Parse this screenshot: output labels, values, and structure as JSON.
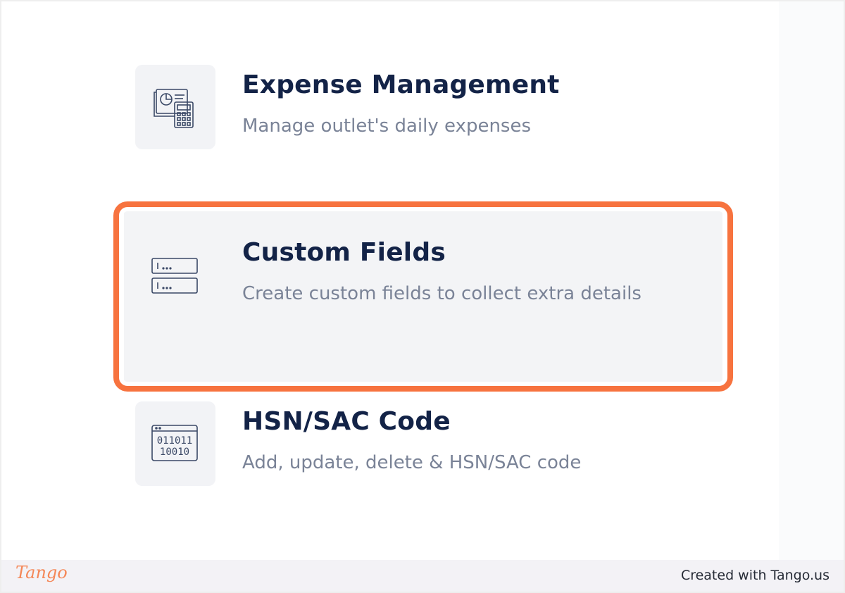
{
  "settings_items": [
    {
      "title": "Expense Management",
      "description": "Manage outlet's daily expenses",
      "icon": "expense-calculator-icon"
    },
    {
      "title": "Custom Fields",
      "description": "Create custom fields to collect extra details",
      "icon": "custom-fields-icon",
      "highlighted": true
    },
    {
      "title": "HSN/SAC Code",
      "description": "Add, update, delete & HSN/SAC code",
      "icon": "binary-code-icon",
      "icon_text": [
        "011011",
        "10010"
      ]
    }
  ],
  "footer": {
    "logo": "Tango",
    "credit": "Created with Tango.us"
  },
  "colors": {
    "highlight": "#f7733f",
    "title": "#132347",
    "description": "#7a8397",
    "icon_stroke": "#3a4866"
  }
}
